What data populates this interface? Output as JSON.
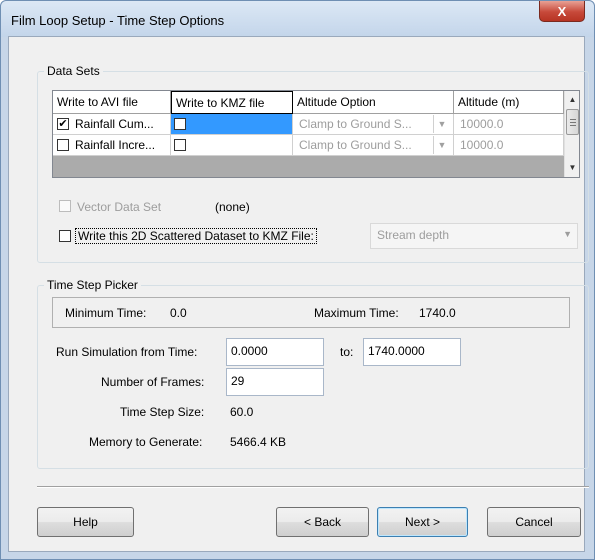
{
  "window": {
    "title": "Film Loop Setup - Time Step Options",
    "close_label": "X"
  },
  "data_sets": {
    "legend": "Data Sets",
    "columns": [
      "Write to AVI file",
      "Write to KMZ file",
      "Altitude Option",
      "Altitude (m)"
    ],
    "rows": [
      {
        "avi_checked": "✔",
        "name": "Rainfall Cum...",
        "altitude_option": "Clamp to Ground S...",
        "altitude": "10000.0"
      },
      {
        "avi_checked": "",
        "name": "Rainfall Incre...",
        "altitude_option": "Clamp to Ground S...",
        "altitude": "10000.0"
      }
    ],
    "vector_label": "Vector Data Set",
    "vector_value": "(none)",
    "scatter_label": "Write this 2D Scattered Dataset to KMZ File:",
    "scatter_dropdown": "Stream depth"
  },
  "time_step_picker": {
    "legend": "Time Step Picker",
    "min_label": "Minimum Time:",
    "min_value": "0.0",
    "max_label": "Maximum Time:",
    "max_value": "1740.0",
    "run_from_label": "Run Simulation from Time:",
    "run_from_value": "0.0000",
    "to_label": "to:",
    "run_to_value": "1740.0000",
    "frames_label": "Number of Frames:",
    "frames_value": "29",
    "step_size_label": "Time Step Size:",
    "step_size_value": "60.0",
    "memory_label": "Memory to Generate:",
    "memory_value": "5466.4 KB"
  },
  "buttons": {
    "help": "Help",
    "back": "< Back",
    "next": "Next >",
    "cancel": "Cancel"
  },
  "colors": {
    "selection": "#3399ff",
    "title_bg": "#c7d6e8",
    "close_btn": "#c7493a"
  }
}
